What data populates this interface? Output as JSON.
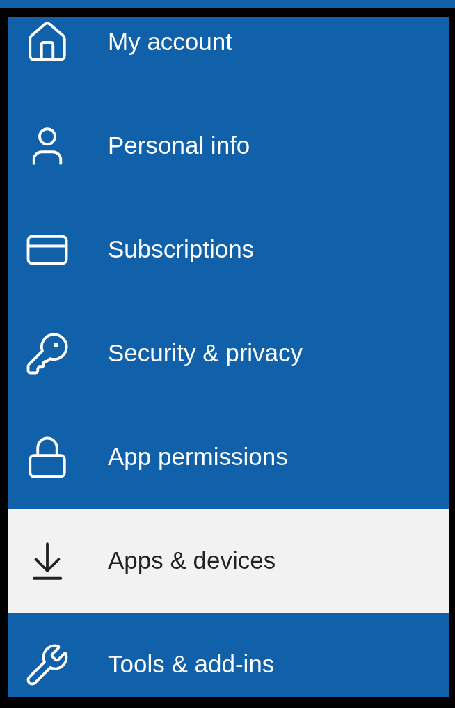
{
  "menu": {
    "items": [
      {
        "label": "My account",
        "selected": false
      },
      {
        "label": "Personal info",
        "selected": false
      },
      {
        "label": "Subscriptions",
        "selected": false
      },
      {
        "label": "Security & privacy",
        "selected": false
      },
      {
        "label": "App permissions",
        "selected": false
      },
      {
        "label": "Apps & devices",
        "selected": true
      },
      {
        "label": "Tools & add-ins",
        "selected": false
      }
    ]
  }
}
